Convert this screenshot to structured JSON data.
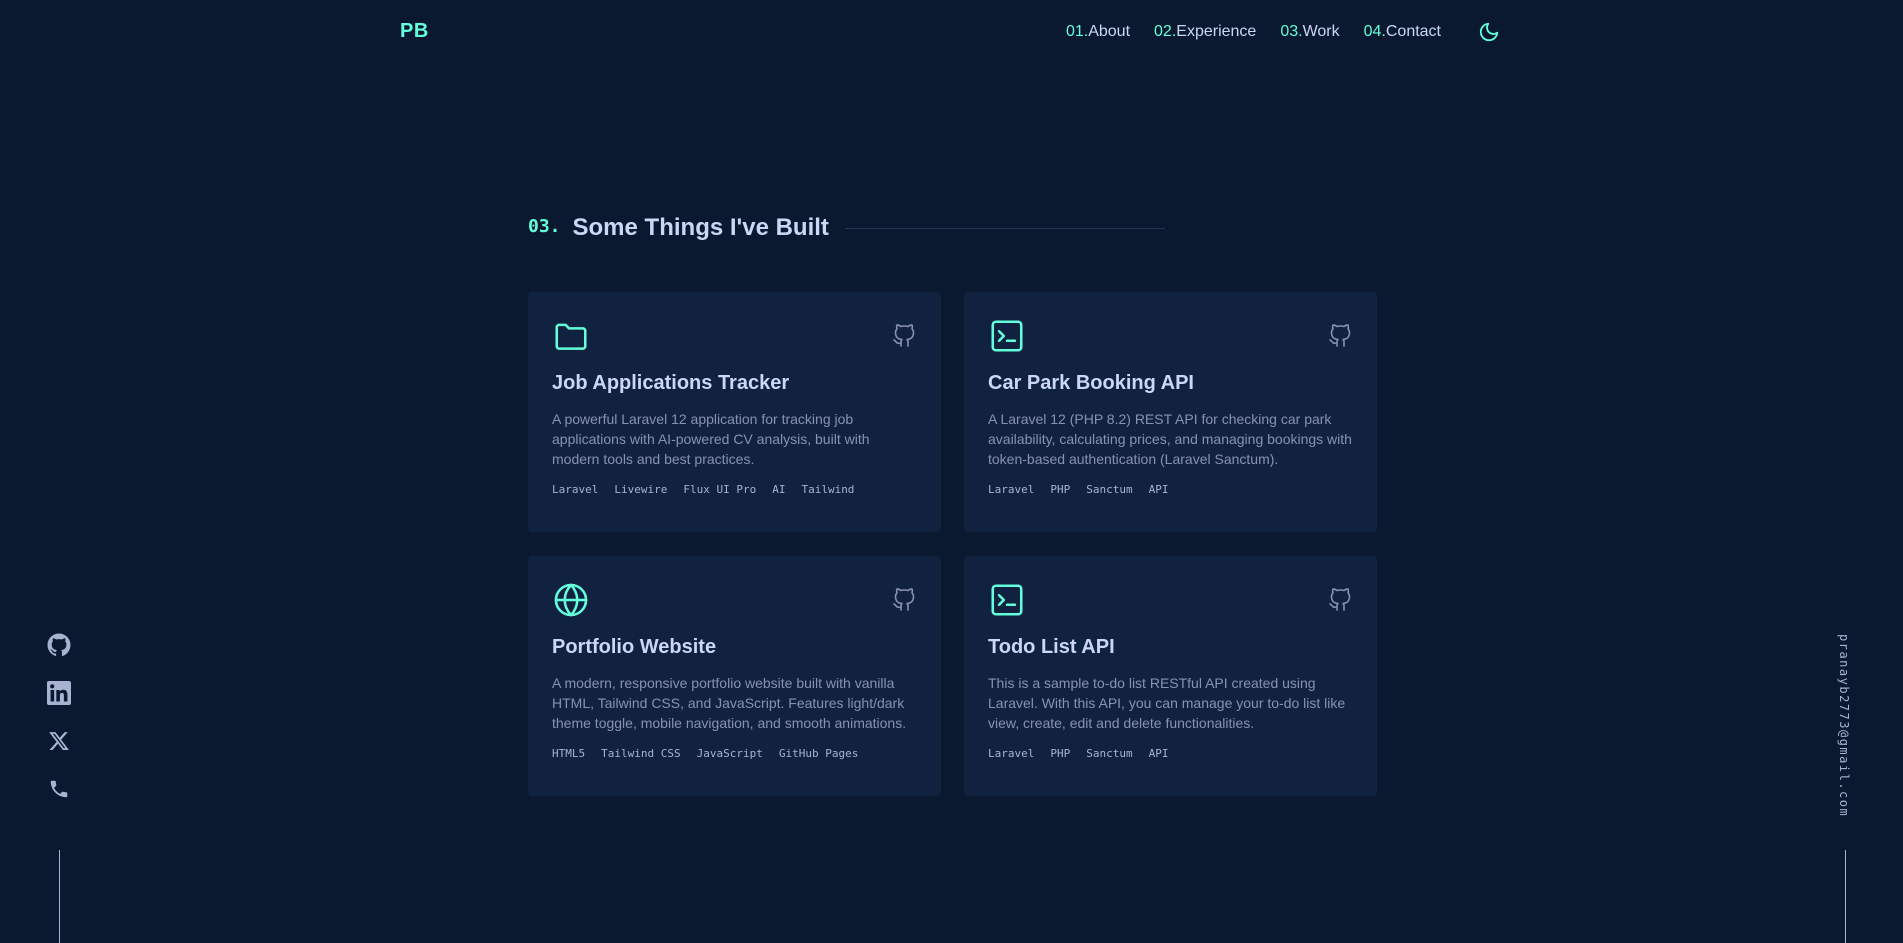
{
  "header": {
    "logo": "PB",
    "nav": [
      {
        "num": "01.",
        "label": "About"
      },
      {
        "num": "02.",
        "label": "Experience"
      },
      {
        "num": "03.",
        "label": "Work"
      },
      {
        "num": "04.",
        "label": "Contact"
      }
    ],
    "theme_icon": "moon-icon"
  },
  "section": {
    "num": "03.",
    "title": "Some Things I've Built"
  },
  "projects": [
    {
      "icon": "folder-icon",
      "title": "Job Applications Tracker",
      "description": "A powerful Laravel 12 application for tracking job applications with AI-powered CV analysis, built with modern tools and best practices.",
      "tech": [
        "Laravel",
        "Livewire",
        "Flux UI Pro",
        "AI",
        "Tailwind"
      ]
    },
    {
      "icon": "terminal-icon",
      "title": "Car Park Booking API",
      "description": "A Laravel 12 (PHP 8.2) REST API for checking car park availability, calculating prices, and managing bookings with token-based authentication (Laravel Sanctum).",
      "tech": [
        "Laravel",
        "PHP",
        "Sanctum",
        "API"
      ]
    },
    {
      "icon": "globe-icon",
      "title": "Portfolio Website",
      "description": "A modern, responsive portfolio website built with vanilla HTML, Tailwind CSS, and JavaScript. Features light/dark theme toggle, mobile navigation, and smooth animations.",
      "tech": [
        "HTML5",
        "Tailwind CSS",
        "JavaScript",
        "GitHub Pages"
      ]
    },
    {
      "icon": "terminal-icon",
      "title": "Todo List API",
      "description": "This is a sample to-do list RESTful API created using Laravel. With this API, you can manage your to-do list like view, create, edit and delete functionalities.",
      "tech": [
        "Laravel",
        "PHP",
        "Sanctum",
        "API"
      ]
    }
  ],
  "social": [
    "github-icon",
    "linkedin-icon",
    "x-icon",
    "phone-icon"
  ],
  "email": "pranayb2773@gmail.com",
  "colors": {
    "background": "#0a192f",
    "card": "#112240",
    "accent": "#64ffda",
    "text": "#ccd6f6",
    "muted": "#8892b0"
  }
}
